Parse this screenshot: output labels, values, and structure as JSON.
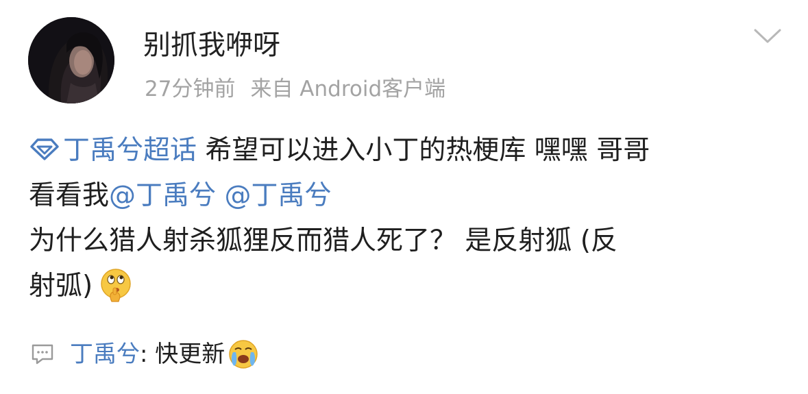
{
  "post": {
    "author": {
      "name": "别抓我咿呀",
      "avatar": "avatar-photo"
    },
    "time": "27分钟前",
    "source": "来自 Android客户端",
    "content": {
      "topic_icon": "diamond-topic-icon",
      "topic": "丁禹兮超话",
      "text_line1": " 希望可以进入小丁的热梗库 嘿嘿 哥哥",
      "text_line2_prefix": "看看我",
      "mention1": "@丁禹兮",
      "mention2": "@丁禹兮",
      "text_line3": "为什么猎人射杀狐狸反而猎人死了？ 是反射狐 (反",
      "text_line4": "射弧)",
      "emoji": "thinking-face-icon"
    },
    "comment": {
      "icon": "comment-icon",
      "author": "丁禹兮",
      "text": ": 快更新",
      "emoji": "crying-face-icon"
    },
    "menu_icon": "chevron-down-icon",
    "colors": {
      "link": "#4a7cbf",
      "meta": "#a3a3a3",
      "text": "#1f1f1f"
    }
  }
}
